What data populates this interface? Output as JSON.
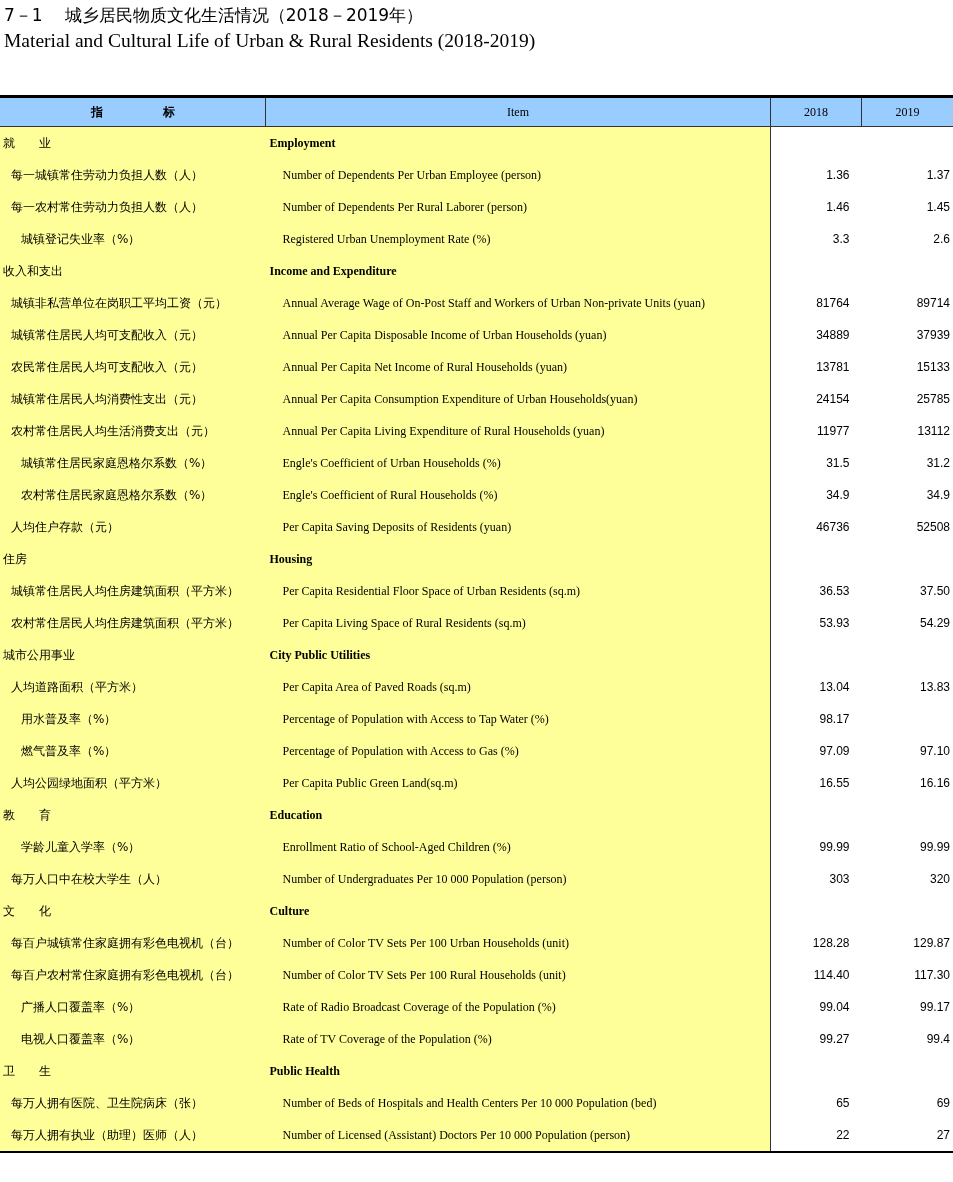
{
  "title": {
    "number": "7－1",
    "text": "城乡居民物质文化生活情况（2018－2019年）",
    "english": "Material and Cultural Life of Urban & Rural Residents (2018-2019)"
  },
  "table": {
    "columns": [
      "指　　　　　标",
      "Item",
      "2018",
      "2019"
    ],
    "rows": [
      {
        "kind": "category",
        "zh": "就　　业",
        "en": "Employment",
        "v2018": "",
        "v2019": ""
      },
      {
        "kind": "item",
        "zh": "每一城镇常住劳动力负担人数（人）",
        "en": "Number of Dependents Per Urban Employee (person)",
        "v2018": "1.36",
        "v2019": "1.37"
      },
      {
        "kind": "item",
        "zh": "每一农村常住劳动力负担人数（人）",
        "en": "Number of Dependents Per Rural Laborer (person)",
        "v2018": "1.46",
        "v2019": "1.45"
      },
      {
        "kind": "inset",
        "zh": "城镇登记失业率（%）",
        "en": "Registered Urban Unemployment Rate (%)",
        "v2018": "3.3",
        "v2019": "2.6"
      },
      {
        "kind": "category",
        "zh": "收入和支出",
        "en": "Income and Expenditure",
        "v2018": "",
        "v2019": ""
      },
      {
        "kind": "item",
        "zh": "城镇非私营单位在岗职工平均工资（元）",
        "en": "Annual Average Wage of On-Post Staff and Workers of Urban Non-private Units (yuan)",
        "v2018": "81764",
        "v2019": "89714"
      },
      {
        "kind": "item",
        "zh": "城镇常住居民人均可支配收入（元）",
        "en": "Annual Per Capita Disposable Income of Urban Households (yuan)",
        "v2018": "34889",
        "v2019": "37939"
      },
      {
        "kind": "item",
        "zh": "农民常住居民人均可支配收入（元）",
        "en": "Annual Per Capita Net Income of Rural Households (yuan)",
        "v2018": "13781",
        "v2019": "15133"
      },
      {
        "kind": "item",
        "zh": "城镇常住居民人均消费性支出（元）",
        "en": "Annual Per Capita Consumption Expenditure of Urban Households(yuan)",
        "v2018": "24154",
        "v2019": "25785"
      },
      {
        "kind": "item",
        "zh": "农村常住居民人均生活消费支出（元）",
        "en": "Annual Per Capita Living Expenditure of Rural Households (yuan)",
        "v2018": "11977",
        "v2019": "13112"
      },
      {
        "kind": "inset",
        "zh": "城镇常住居民家庭恩格尔系数（%）",
        "en": "Engle's Coefficient of Urban Households (%)",
        "v2018": "31.5",
        "v2019": "31.2"
      },
      {
        "kind": "inset",
        "zh": "农村常住居民家庭恩格尔系数（%）",
        "en": "Engle's Coefficient of Rural Households (%)",
        "v2018": "34.9",
        "v2019": "34.9"
      },
      {
        "kind": "item",
        "zh": "人均住户存款（元）",
        "en": "Per Capita Saving Deposits of Residents (yuan)",
        "v2018": "46736",
        "v2019": "52508"
      },
      {
        "kind": "category",
        "zh": "住房",
        "en": "Housing",
        "v2018": "",
        "v2019": ""
      },
      {
        "kind": "item",
        "zh": "城镇常住居民人均住房建筑面积（平方米）",
        "en": "Per Capita Residential Floor Space of Urban Residents (sq.m)",
        "v2018": "36.53",
        "v2019": "37.50"
      },
      {
        "kind": "item",
        "zh": "农村常住居民人均住房建筑面积（平方米）",
        "en": "Per Capita Living Space of Rural Residents (sq.m)",
        "v2018": "53.93",
        "v2019": "54.29"
      },
      {
        "kind": "category",
        "zh": "城市公用事业",
        "en": "City Public Utilities",
        "v2018": "",
        "v2019": ""
      },
      {
        "kind": "item",
        "zh": "人均道路面积（平方米）",
        "en": "Per Capita Area of Paved Roads (sq.m)",
        "v2018": "13.04",
        "v2019": "13.83"
      },
      {
        "kind": "inset",
        "zh": "用水普及率（%）",
        "en": "Percentage of Population with Access to Tap Water (%)",
        "v2018": "98.17",
        "v2019": ""
      },
      {
        "kind": "inset",
        "zh": "燃气普及率（%）",
        "en": "Percentage of Population with Access to Gas (%)",
        "v2018": "97.09",
        "v2019": "97.10"
      },
      {
        "kind": "item",
        "zh": "人均公园绿地面积（平方米）",
        "en": "Per Capita Public Green Land(sq.m)",
        "v2018": "16.55",
        "v2019": "16.16"
      },
      {
        "kind": "category",
        "zh": "教　　育",
        "en": "Education",
        "v2018": "",
        "v2019": ""
      },
      {
        "kind": "inset",
        "zh": "学龄儿童入学率（%）",
        "en": "Enrollment Ratio of School-Aged Children (%)",
        "v2018": "99.99",
        "v2019": "99.99"
      },
      {
        "kind": "item",
        "zh": "每万人口中在校大学生（人）",
        "en": "Number of Undergraduates Per 10 000 Population (person)",
        "v2018": "303",
        "v2019": "320"
      },
      {
        "kind": "category",
        "zh": "文　　化",
        "en": "Culture",
        "v2018": "",
        "v2019": ""
      },
      {
        "kind": "item",
        "zh": "每百户城镇常住家庭拥有彩色电视机（台）",
        "en": "Number of Color TV Sets Per 100 Urban Households (unit)",
        "v2018": "128.28",
        "v2019": "129.87"
      },
      {
        "kind": "item",
        "zh": "每百户农村常住家庭拥有彩色电视机（台）",
        "en": "Number of Color TV Sets Per 100 Rural Households (unit)",
        "v2018": "114.40",
        "v2019": "117.30"
      },
      {
        "kind": "inset",
        "zh": "广播人口覆盖率（%）",
        "en": "Rate of Radio Broadcast Coverage of the Population (%)",
        "v2018": "99.04",
        "v2019": "99.17"
      },
      {
        "kind": "inset",
        "zh": "电视人口覆盖率（%）",
        "en": "Rate of TV Coverage of the Population (%)",
        "v2018": "99.27",
        "v2019": "99.4"
      },
      {
        "kind": "category",
        "zh": "卫　　生",
        "en": "Public Health",
        "v2018": "",
        "v2019": ""
      },
      {
        "kind": "item",
        "zh": "每万人拥有医院、卫生院病床（张）",
        "en": "Number of Beds of Hospitals and Health Centers Per 10 000 Population (bed)",
        "v2018": "65",
        "v2019": "69"
      },
      {
        "kind": "item",
        "zh": "每万人拥有执业（助理）医师（人）",
        "en": "Number of Licensed (Assistant) Doctors Per 10 000 Population (person)",
        "v2018": "22",
        "v2019": "27"
      }
    ]
  }
}
